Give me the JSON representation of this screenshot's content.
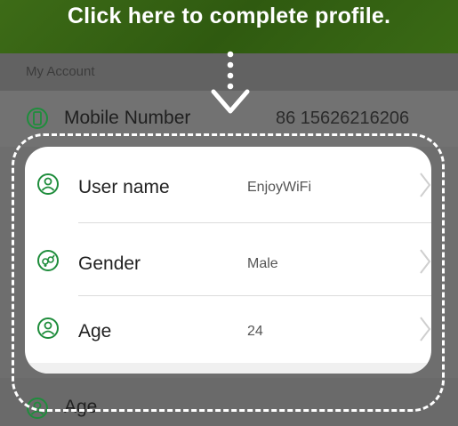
{
  "banner": {
    "text": "Click here to complete profile."
  },
  "section": {
    "title": "My Account"
  },
  "background_rows": [
    {
      "label": "Mobile Number",
      "value": "86 15626216206",
      "icon": "phone-icon"
    },
    {
      "label": "Age",
      "icon": "person-icon"
    }
  ],
  "card": {
    "rows": [
      {
        "label": "User name",
        "value": "EnjoyWiFi",
        "icon": "person-icon"
      },
      {
        "label": "Gender",
        "value": "Male",
        "icon": "gender-icon"
      },
      {
        "label": "Age",
        "value": "24",
        "icon": "person-icon"
      }
    ]
  },
  "colors": {
    "accent_green": "#1f8d3c",
    "banner_green": "#3d6b17"
  }
}
